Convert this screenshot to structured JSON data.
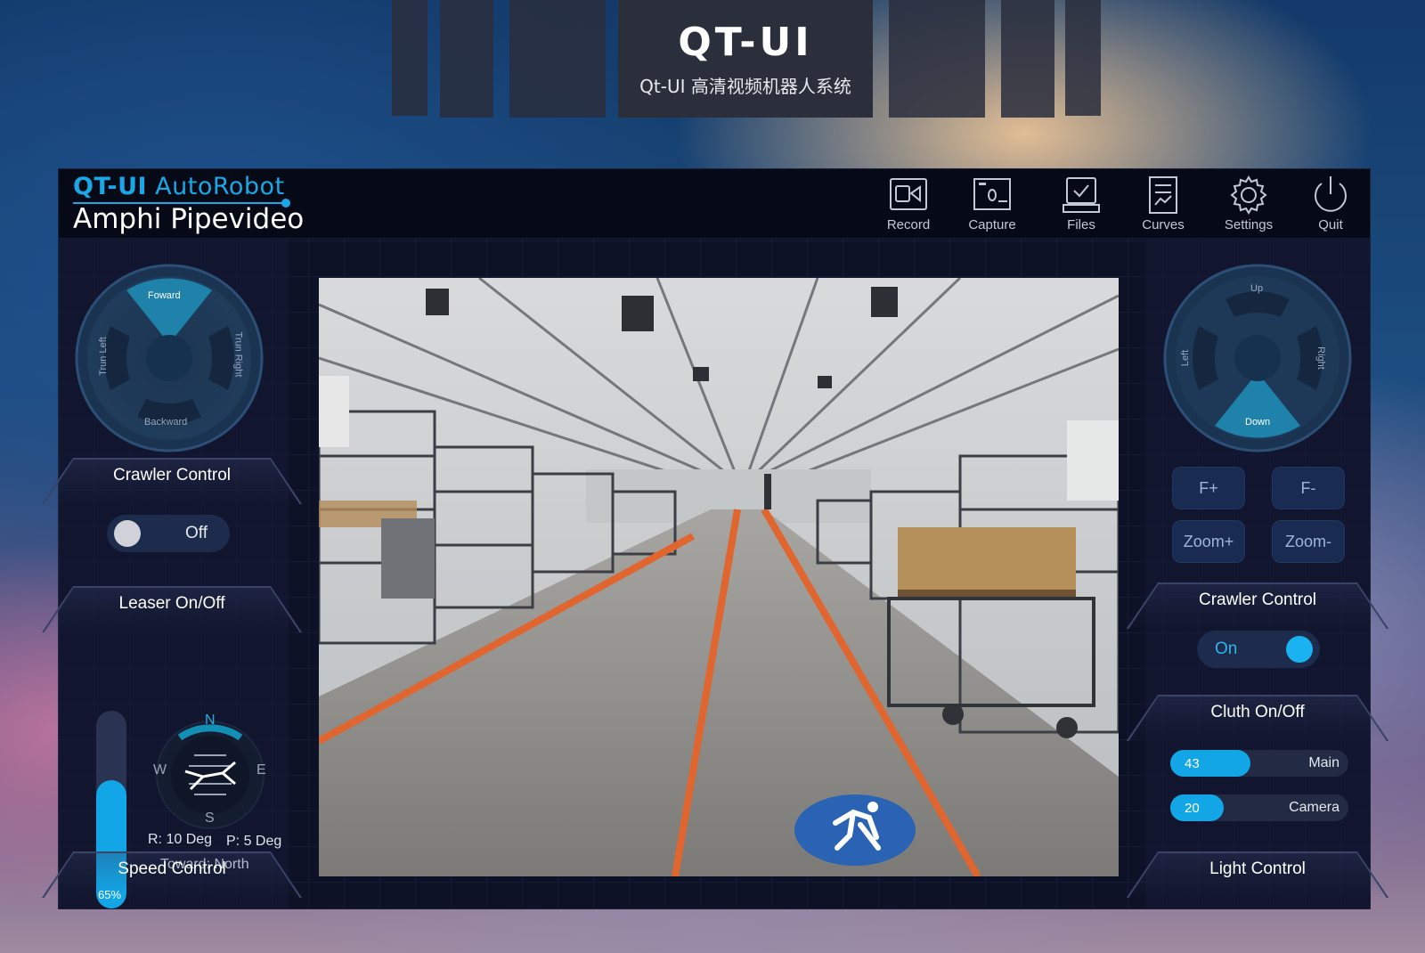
{
  "banner": {
    "logo": "QT-UI",
    "subtitle": "Qt-UI 高清视频机器人系统"
  },
  "brand": {
    "top_main": "QT-UI",
    "top_auto": " AutoRobot",
    "bottom": "Amphi Pipevideo"
  },
  "toolbar": [
    {
      "label": "Record",
      "icon": "record-icon"
    },
    {
      "label": "Capture",
      "icon": "capture-icon"
    },
    {
      "label": "Files",
      "icon": "files-icon"
    },
    {
      "label": "Curves",
      "icon": "curves-icon"
    },
    {
      "label": "Settings",
      "icon": "gear-icon"
    },
    {
      "label": "Quit",
      "icon": "power-icon"
    }
  ],
  "left": {
    "dpad": {
      "up": "Foward",
      "down": "Backward",
      "left": "Trun Left",
      "right": "Trun Right"
    },
    "crawler_title": "Crawler Control",
    "crawler_toggle": "Off",
    "leaser_title": "Leaser On/Off",
    "level": {
      "value": 0.65,
      "label": "65%"
    },
    "compass": {
      "n": "N",
      "s": "S",
      "e": "E",
      "w": "W"
    },
    "roll": "R: 10 Deg",
    "pitch": "P: 5 Deg",
    "toward": "Toward: North",
    "speed_title": "Speed Control"
  },
  "right": {
    "dpad": {
      "up": "Up",
      "down": "Down",
      "left": "Left",
      "right": "Right"
    },
    "buttons": [
      "F+",
      "F-",
      "Zoom+",
      "Zoom-"
    ],
    "crawler_title": "Crawler Control",
    "crawler_toggle": "On",
    "cluth_title": "Cluth On/Off",
    "sliders": [
      {
        "value": "43",
        "name": "Main",
        "fraction": 0.45
      },
      {
        "value": "20",
        "name": "Camera",
        "fraction": 0.3
      }
    ],
    "light_title": "Light Control"
  },
  "colors": {
    "accent": "#12a6e6",
    "panel_bg": "#0e1226",
    "header_bg": "#060a16"
  }
}
